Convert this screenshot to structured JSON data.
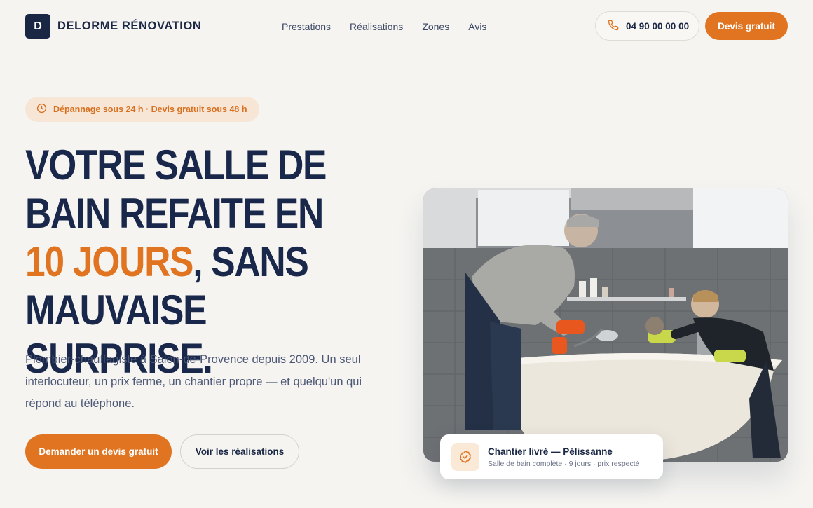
{
  "brand": {
    "mark": "D",
    "name": "DELORME RÉNOVATION"
  },
  "nav": {
    "items": [
      "Prestations",
      "Réalisations",
      "Zones",
      "Avis"
    ]
  },
  "header": {
    "phone": "04 90 00 00 00",
    "phone_icon": "phone-icon",
    "cta": "Devis gratuit"
  },
  "hero": {
    "badge": "Dépannage sous 24 h · Devis gratuit sous 48 h",
    "badge_icon": "clock-icon",
    "headline": {
      "line1": "VOTRE SALLE DE",
      "line2": "BAIN REFAITE EN",
      "accent": "10 JOURS",
      "after_accent": ", SANS",
      "line4": "MAUVAISE SURPRISE."
    },
    "lead": "Plombier-chauffagiste à Salon-de-Provence depuis 2009. Un seul interlocuteur, un prix ferme, un chantier propre — et quelqu'un qui répond au téléphone.",
    "primary_cta": "Demander un devis gratuit",
    "secondary_cta": "Voir les réalisations"
  },
  "proof": {
    "icon": "check-badge-icon",
    "title": "Chantier livré — Pélissanne",
    "subtitle": "Salle de bain complète · 9 jours · prix respecté"
  },
  "colors": {
    "navy": "#1a2744",
    "accent": "#e07420",
    "background": "#f5f4f1"
  }
}
